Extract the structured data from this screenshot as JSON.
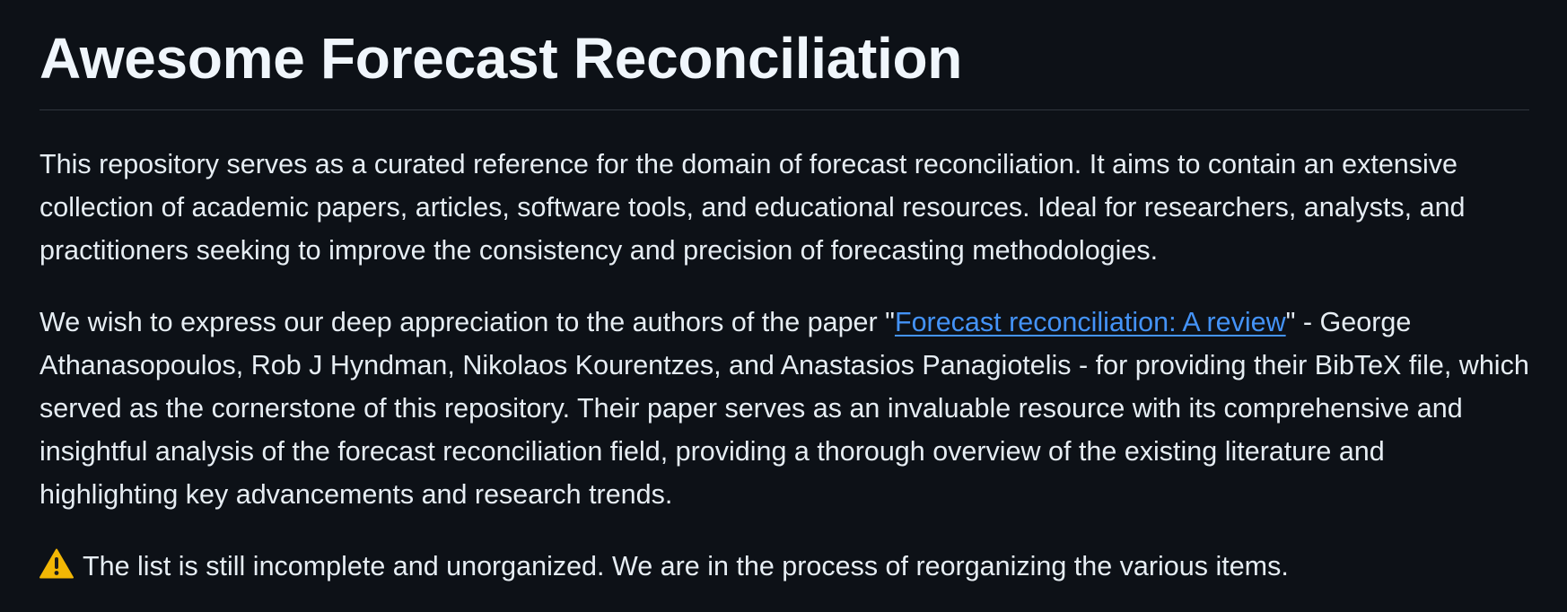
{
  "readme": {
    "title": "Awesome Forecast Reconciliation",
    "intro": "This repository serves as a curated reference for the domain of forecast reconciliation. It aims to contain an extensive collection of academic papers, articles, software tools, and educational resources. Ideal for researchers, analysts, and practitioners seeking to improve the consistency and precision of forecasting methodologies.",
    "acknowledgement": {
      "before_link": "We wish to express our deep appreciation to the authors of the paper \"",
      "link_text": "Forecast reconciliation: A review",
      "after_link": "\" - George Athanasopoulos, Rob J Hyndman, Nikolaos Kourentzes, and Anastasios Panagiotelis - for providing their BibTeX file, which served as the cornerstone of this repository. Their paper serves as an invaluable resource with its comprehensive and insightful analysis of the forecast reconciliation field, providing a thorough overview of the existing literature and highlighting key advancements and research trends."
    },
    "warning": {
      "icon": "warning-icon",
      "text": "The list is still incomplete and unorganized. We are in the process of reorganizing the various items."
    }
  },
  "colors": {
    "background": "#0d1117",
    "text": "#e6edf3",
    "link": "#4493f8",
    "divider": "#30363d",
    "warning_icon": "#f2b705"
  }
}
